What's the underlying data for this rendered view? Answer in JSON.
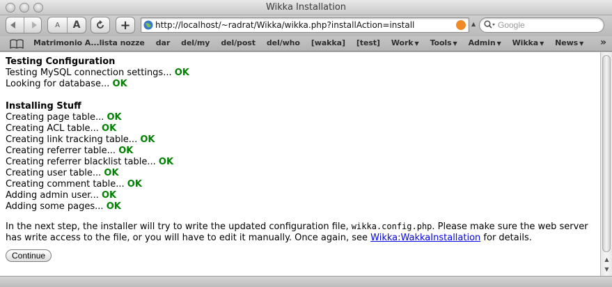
{
  "window": {
    "title": "Wikka Installation"
  },
  "toolbar": {
    "back_icon": "back-arrow-icon",
    "forward_icon": "forward-arrow-icon",
    "text_smaller_label": "A",
    "text_bigger_label": "A",
    "reload_icon": "reload-icon",
    "add_bookmark_label": "+",
    "url": "http://localhost/~radrat/Wikka/wikka.php?installAction=install",
    "search_placeholder": "Google"
  },
  "bookmarks": [
    {
      "label": "Matrimonio A...lista nozze",
      "menu": false
    },
    {
      "label": "dar",
      "menu": false
    },
    {
      "label": "del/my",
      "menu": false
    },
    {
      "label": "del/post",
      "menu": false
    },
    {
      "label": "del/who",
      "menu": false
    },
    {
      "label": "[wakka]",
      "menu": false
    },
    {
      "label": "[test]",
      "menu": false
    },
    {
      "label": "Work",
      "menu": true
    },
    {
      "label": "Tools",
      "menu": true
    },
    {
      "label": "Admin",
      "menu": true
    },
    {
      "label": "Wikka",
      "menu": true
    },
    {
      "label": "News",
      "menu": true
    }
  ],
  "bookmarks_overflow": "»",
  "content": {
    "heading_testing": "Testing Configuration",
    "testing": [
      {
        "text": "Testing MySQL connection settings...",
        "status": "OK"
      },
      {
        "text": "Looking for database...",
        "status": "OK"
      }
    ],
    "heading_installing": "Installing Stuff",
    "installing": [
      {
        "text": "Creating page table...",
        "status": "OK"
      },
      {
        "text": "Creating ACL table...",
        "status": "OK"
      },
      {
        "text": "Creating link tracking table...",
        "status": "OK"
      },
      {
        "text": "Creating referrer table...",
        "status": "OK"
      },
      {
        "text": "Creating referrer blacklist table...",
        "status": "OK"
      },
      {
        "text": "Creating user table...",
        "status": "OK"
      },
      {
        "text": "Creating comment table...",
        "status": "OK"
      },
      {
        "text": "Adding admin user...",
        "status": "OK"
      },
      {
        "text": "Adding some pages...",
        "status": "OK"
      }
    ],
    "para_before_code": "In the next step, the installer will try to write the updated configuration file, ",
    "config_file": "wikka.config.php",
    "para_middle": ". Please make sure the web server has write access to the file, or you will have to edit it manually. Once again, see ",
    "link_text": "Wikka:WakkaInstallation",
    "para_after": " for details.",
    "continue_label": "Continue"
  },
  "colors": {
    "ok": "#008000",
    "link": "#0000ee"
  }
}
